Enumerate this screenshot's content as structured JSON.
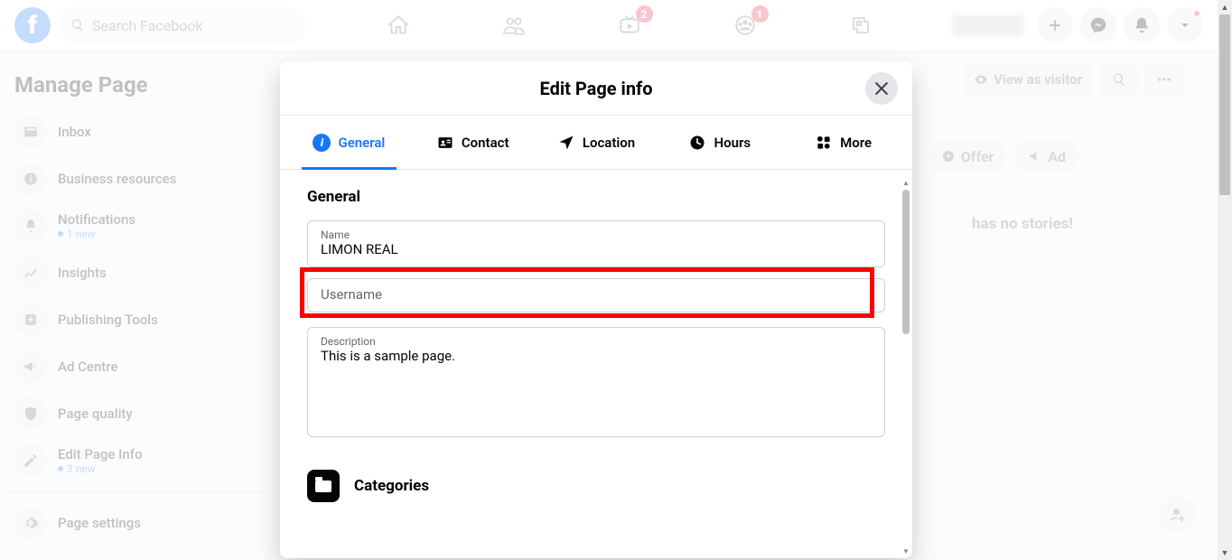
{
  "header": {
    "search_placeholder": "Search Facebook",
    "badge_watch": "2",
    "badge_groups": "1"
  },
  "sidebar": {
    "title": "Manage Page",
    "items": [
      {
        "label": "Inbox",
        "icon": "inbox"
      },
      {
        "label": "Business resources",
        "icon": "info"
      },
      {
        "label": "Notifications",
        "icon": "bell",
        "sub": "1 new"
      },
      {
        "label": "Insights",
        "icon": "stats"
      },
      {
        "label": "Publishing Tools",
        "icon": "plus-box"
      },
      {
        "label": "Ad Centre",
        "icon": "megaphone"
      },
      {
        "label": "Page quality",
        "icon": "shield"
      },
      {
        "label": "Edit Page Info",
        "icon": "pencil",
        "sub": "3 new"
      }
    ],
    "settings_label": "Page settings"
  },
  "page_bar": {
    "view_as": "View as visitor",
    "chip_offer": "Offer",
    "chip_ad": "Ad",
    "no_stories": "has no stories!"
  },
  "modal": {
    "title": "Edit Page info",
    "tabs": {
      "general": "General",
      "contact": "Contact",
      "location": "Location",
      "hours": "Hours",
      "more": "More"
    },
    "section_general": "General",
    "name_label": "Name",
    "name_value": "LIMON REAL",
    "username_placeholder": "Username",
    "desc_label": "Description",
    "desc_value": "This is a sample page.",
    "categories_label": "Categories"
  }
}
